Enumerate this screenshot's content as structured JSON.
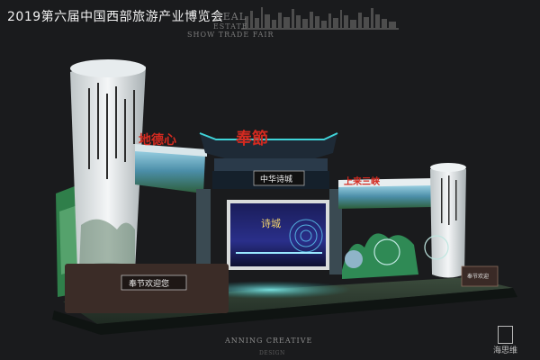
{
  "header": {
    "title": "2019第六届中国西部旅游产业博览会"
  },
  "watermark": {
    "line1": "REAL",
    "line2": "ESTATE",
    "line3": "SHOW TRADE FAIR"
  },
  "booth": {
    "center_sign": "奉節",
    "left_sign": "地德心",
    "right_sign": "上来三峡",
    "board_sign": "中华诗城",
    "front_plaque": "奉节欢迎您",
    "small_placard": "奉节欢迎",
    "screen_text": "诗城"
  },
  "footer": {
    "credit": "ANNING CREATIVE",
    "credit_sub": "DESIGN",
    "logo_text": "海思维"
  },
  "colors": {
    "background": "#1a1b1d",
    "accent_red": "#d32a20",
    "accent_cyan": "#3fd3d8",
    "screen_blue": "#2a2f8a"
  }
}
